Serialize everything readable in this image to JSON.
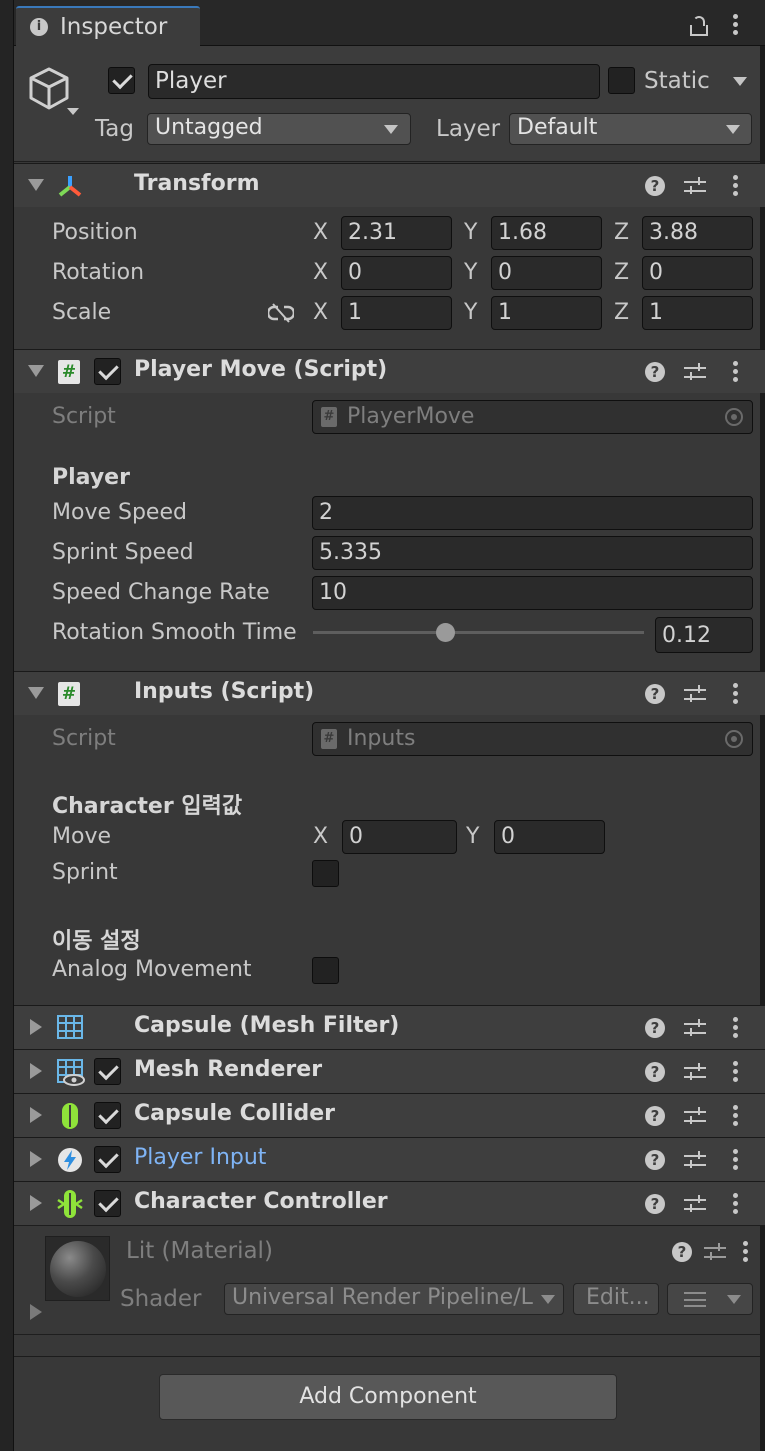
{
  "tab": {
    "title": "Inspector"
  },
  "object": {
    "name": "Player",
    "static_label": "Static",
    "tag_label": "Tag",
    "tag_value": "Untagged",
    "layer_label": "Layer",
    "layer_value": "Default"
  },
  "transform": {
    "title": "Transform",
    "position": {
      "label": "Position",
      "x": "2.31",
      "y": "1.68",
      "z": "3.88"
    },
    "rotation": {
      "label": "Rotation",
      "x": "0",
      "y": "0",
      "z": "0"
    },
    "scale": {
      "label": "Scale",
      "x": "1",
      "y": "1",
      "z": "1"
    },
    "axis_x": "X",
    "axis_y": "Y",
    "axis_z": "Z"
  },
  "player_move": {
    "title": "Player Move (Script)",
    "script_label": "Script",
    "script_value": "PlayerMove",
    "section": "Player",
    "move_speed": {
      "label": "Move Speed",
      "value": "2"
    },
    "sprint_speed": {
      "label": "Sprint Speed",
      "value": "5.335"
    },
    "speed_change_rate": {
      "label": "Speed Change Rate",
      "value": "10"
    },
    "rotation_smooth_time": {
      "label": "Rotation Smooth Time",
      "value": "0.12",
      "slider_fraction": 0.4
    }
  },
  "inputs": {
    "title": "Inputs (Script)",
    "script_label": "Script",
    "script_value": "Inputs",
    "section1": "Character 입력값",
    "move": {
      "label": "Move",
      "x": "0",
      "y": "0"
    },
    "sprint_label": "Sprint",
    "section2": "이동 설정",
    "analog_label": "Analog Movement"
  },
  "components": [
    {
      "title": "Capsule (Mesh Filter)",
      "icon": "mesh-filter-icon",
      "has_checkbox": false
    },
    {
      "title": "Mesh Renderer",
      "icon": "mesh-renderer-icon",
      "has_checkbox": true
    },
    {
      "title": "Capsule Collider",
      "icon": "capsule-collider-icon",
      "has_checkbox": true
    },
    {
      "title": "Player Input",
      "icon": "player-input-icon",
      "has_checkbox": true,
      "color": "#7fb4f5"
    },
    {
      "title": "Character Controller",
      "icon": "character-controller-icon",
      "has_checkbox": true
    }
  ],
  "material": {
    "title": "Lit (Material)",
    "shader_label": "Shader",
    "shader_value": "Universal Render Pipeline/L",
    "edit_label": "Edit..."
  },
  "add_component": "Add Component",
  "colors": {
    "panel": "#383838",
    "header": "#3e3e3e",
    "field": "#2a2a2a",
    "link": "#7fb4f5",
    "collider": "#8fe33a"
  }
}
